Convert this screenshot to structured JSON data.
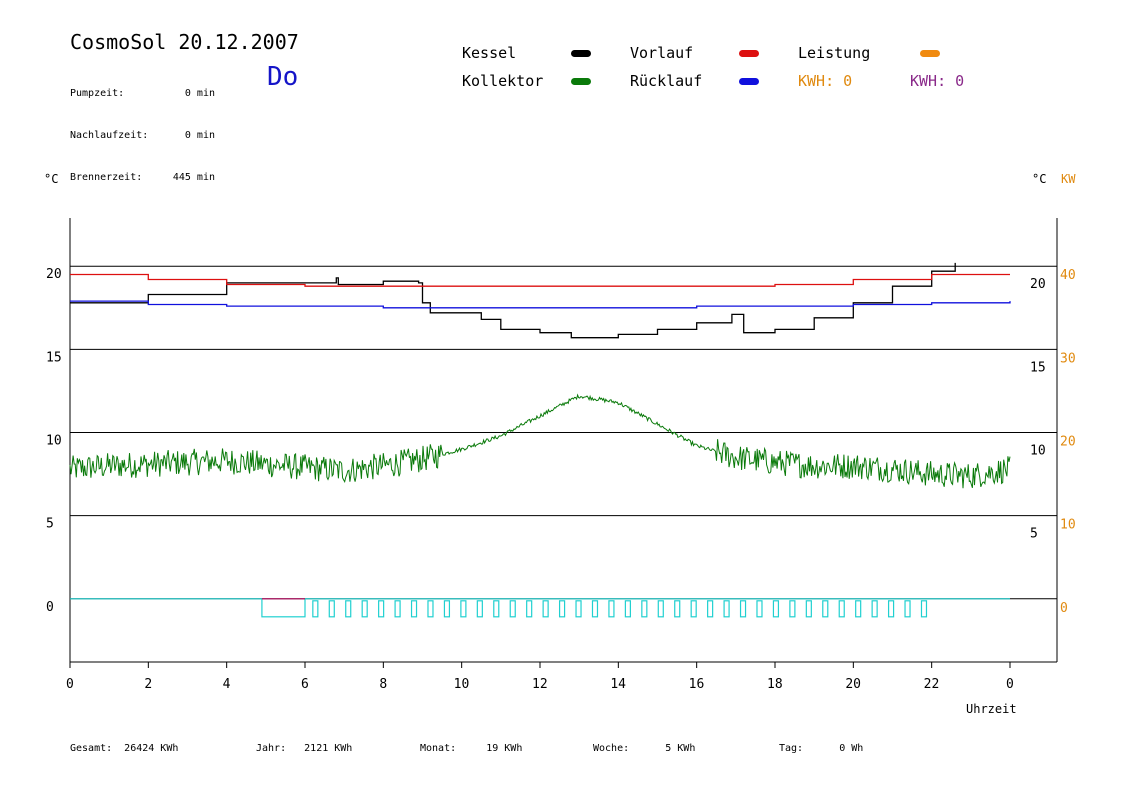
{
  "header": {
    "title": "CosmoSol 20.12.2007",
    "day": "Do",
    "stats": [
      {
        "label": "Pumpzeit:",
        "value": "0 min"
      },
      {
        "label": "Nachlaufzeit:",
        "value": "0 min"
      },
      {
        "label": "Brennerzeit:",
        "value": "445 min"
      }
    ]
  },
  "legend": {
    "kessel": "Kessel",
    "kollektor": "Kollektor",
    "vorlauf": "Vorlauf",
    "ruecklauf": "Rücklauf",
    "leistung": "Leistung",
    "kwh_orange": "KWH: 0",
    "kwh_purple": "KWH: 0"
  },
  "axes": {
    "left_unit": "°C",
    "right_unit_c": "°C",
    "right_unit_kw": "KW",
    "x_label": "Uhrzeit"
  },
  "footer": {
    "gesamt": "Gesamt:  26424 KWh",
    "jahr": "Jahr:   2121 KWh",
    "monat": "Monat:     19 KWh",
    "woche": "Woche:      5 KWh",
    "tag": "Tag:      0 Wh"
  },
  "colors": {
    "kessel": "#000000",
    "kollektor": "#0a7a0a",
    "vorlauf": "#dd1010",
    "ruecklauf": "#1010dd",
    "leistung": "#f08a10",
    "kwh_orange": "#e08a10",
    "kwh_purple": "#8a2a8a",
    "pump": "#20d0d0",
    "brenner": "#aa2a6a"
  },
  "chart_data": {
    "type": "line",
    "xlabel": "Uhrzeit",
    "xlim": [
      0,
      24
    ],
    "x_ticks": [
      0,
      2,
      4,
      6,
      8,
      10,
      12,
      14,
      16,
      18,
      20,
      22,
      24
    ],
    "x_tick_labels": [
      "0",
      "2",
      "4",
      "6",
      "8",
      "10",
      "12",
      "14",
      "16",
      "18",
      "20",
      "22",
      "0"
    ],
    "ylim_left": [
      -3.8,
      22.9
    ],
    "y_ticks_left": [
      0,
      5,
      10,
      15,
      20
    ],
    "y_ticks_inner_right": [
      5,
      10,
      15,
      20
    ],
    "y_ticks_kw": [
      0,
      10,
      20,
      30,
      40
    ],
    "kw_scale": 2,
    "series": [
      {
        "name": "Kessel",
        "key": "kessel",
        "points": [
          [
            0,
            17.8
          ],
          [
            2,
            18.3
          ],
          [
            4,
            19.0
          ],
          [
            6.8,
            19.3
          ],
          [
            6.85,
            18.9
          ],
          [
            8,
            19.1
          ],
          [
            8.9,
            19.0
          ],
          [
            9.0,
            17.8
          ],
          [
            9.2,
            17.2
          ],
          [
            10.5,
            16.8
          ],
          [
            11,
            16.2
          ],
          [
            12,
            16.0
          ],
          [
            12.8,
            15.7
          ],
          [
            14,
            15.9
          ],
          [
            15,
            16.2
          ],
          [
            16,
            16.6
          ],
          [
            16.9,
            17.1
          ],
          [
            17.2,
            16.0
          ],
          [
            18,
            16.2
          ],
          [
            19,
            16.9
          ],
          [
            20,
            17.8
          ],
          [
            21,
            18.8
          ],
          [
            22,
            19.7
          ],
          [
            22.6,
            20.2
          ]
        ]
      },
      {
        "name": "Vorlauf",
        "key": "vorlauf",
        "points": [
          [
            0,
            19.5
          ],
          [
            2,
            19.2
          ],
          [
            4,
            18.9
          ],
          [
            6,
            18.8
          ],
          [
            8,
            18.8
          ],
          [
            10,
            18.8
          ],
          [
            12,
            18.8
          ],
          [
            14,
            18.8
          ],
          [
            16,
            18.8
          ],
          [
            18,
            18.9
          ],
          [
            20,
            19.2
          ],
          [
            22,
            19.5
          ],
          [
            24,
            19.5
          ]
        ]
      },
      {
        "name": "Rücklauf",
        "key": "ruecklauf",
        "points": [
          [
            0,
            17.9
          ],
          [
            2,
            17.7
          ],
          [
            4,
            17.6
          ],
          [
            6,
            17.6
          ],
          [
            8,
            17.5
          ],
          [
            10,
            17.5
          ],
          [
            12,
            17.5
          ],
          [
            14,
            17.5
          ],
          [
            16,
            17.6
          ],
          [
            18,
            17.6
          ],
          [
            20,
            17.7
          ],
          [
            22,
            17.8
          ],
          [
            24,
            17.9
          ]
        ]
      },
      {
        "name": "Kollektor",
        "key": "kollektor",
        "noise": 0.8,
        "points": [
          [
            0,
            7.8
          ],
          [
            1,
            8.0
          ],
          [
            2,
            8.1
          ],
          [
            3,
            8.2
          ],
          [
            4,
            8.3
          ],
          [
            5,
            8.1
          ],
          [
            6,
            7.9
          ],
          [
            7,
            7.7
          ],
          [
            8,
            8.0
          ],
          [
            9,
            8.4
          ],
          [
            10,
            9.0
          ],
          [
            11,
            9.8
          ],
          [
            12,
            11.0
          ],
          [
            13,
            12.2
          ],
          [
            14,
            11.8
          ],
          [
            15,
            10.5
          ],
          [
            16,
            9.2
          ],
          [
            17,
            8.5
          ],
          [
            18,
            8.2
          ],
          [
            19,
            8.0
          ],
          [
            20,
            8.0
          ],
          [
            21,
            7.8
          ],
          [
            22,
            7.5
          ],
          [
            23,
            7.4
          ],
          [
            24,
            7.8
          ]
        ]
      }
    ]
  }
}
